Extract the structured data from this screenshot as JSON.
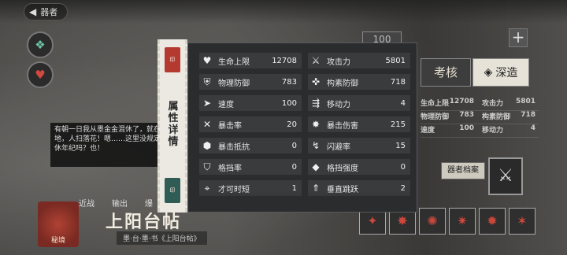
{
  "top_bar": {
    "back_label": "器者",
    "character_title": ""
  },
  "left_icons": [
    {
      "icon": "jade-emblem-icon",
      "color": "#6cc3a6"
    },
    {
      "icon": "heart-affinity-icon",
      "color": "#d2483e"
    }
  ],
  "bio_text": "有朝一日我从墨金金混休了，就在此地，人扫落花！嗯……这里没规定退休年纪吗？也！",
  "bottom_tabs": [
    "近战",
    "输出",
    "爆"
  ],
  "seal_label": "秘境",
  "character_name": "上阳台帖",
  "character_subtitle": "墨·台·墨·书《上阳台帖》",
  "right": {
    "count": "100",
    "plus": "+",
    "assess_label": "考核",
    "forge_label": "深造",
    "mini_stats": [
      [
        "生命上限",
        "12708",
        "攻击力",
        "5801"
      ],
      [
        "物理防御",
        "783",
        "构素防御",
        "718"
      ],
      [
        "速度",
        "100",
        "移动力",
        "4"
      ]
    ],
    "archive_label": "器者档案"
  },
  "ribbon": {
    "title": "属性详情",
    "stamp_top": "印",
    "stamp_bottom": "印"
  },
  "stats": [
    {
      "label": "生命上限",
      "value": "12708",
      "icon": "heart-icon"
    },
    {
      "label": "攻击力",
      "value": "5801",
      "icon": "crossed-swords-icon"
    },
    {
      "label": "物理防御",
      "value": "783",
      "icon": "shield-icon"
    },
    {
      "label": "构素防御",
      "value": "718",
      "icon": "magic-shield-icon"
    },
    {
      "label": "速度",
      "value": "100",
      "icon": "speed-icon"
    },
    {
      "label": "移动力",
      "value": "4",
      "icon": "move-icon"
    },
    {
      "label": "暴击率",
      "value": "20",
      "icon": "crit-rate-icon"
    },
    {
      "label": "暴击伤害",
      "value": "215",
      "icon": "crit-damage-icon"
    },
    {
      "label": "暴击抵抗",
      "value": "0",
      "icon": "crit-resist-icon"
    },
    {
      "label": "闪避率",
      "value": "15",
      "icon": "dodge-icon"
    },
    {
      "label": "格挡率",
      "value": "0",
      "icon": "block-rate-icon"
    },
    {
      "label": "格挡强度",
      "value": "0",
      "icon": "block-strength-icon"
    },
    {
      "label": "才可时短",
      "value": "1",
      "icon": "range-icon"
    },
    {
      "label": "垂直跳跃",
      "value": "2",
      "icon": "jump-icon"
    }
  ],
  "colors": {
    "popup_bg": "#2b2c2e",
    "cell_bg": "#3a3b3d",
    "ribbon_bg": "#ece9e2",
    "accent_red": "#b43a30"
  }
}
